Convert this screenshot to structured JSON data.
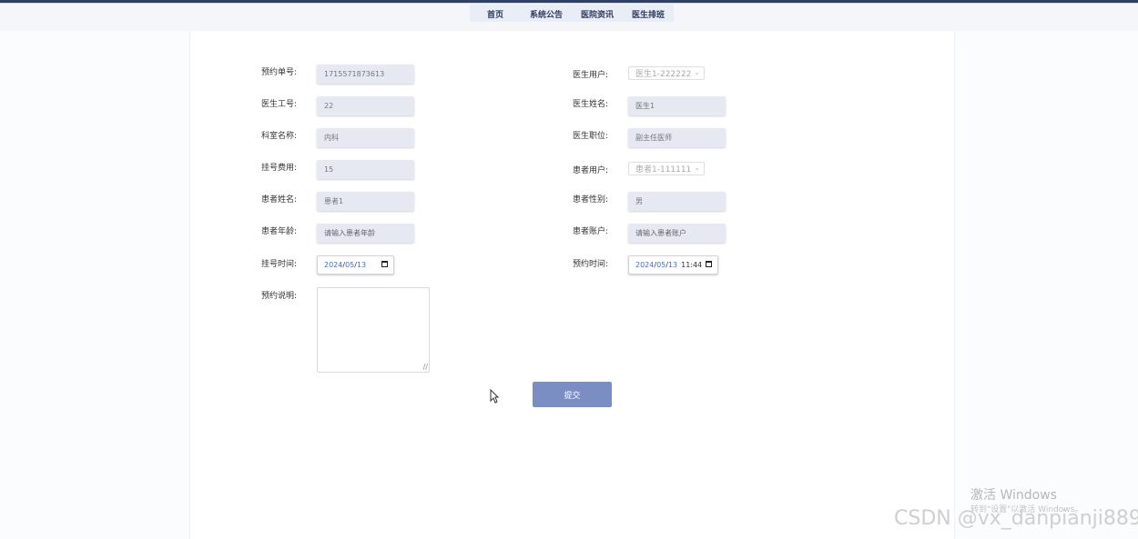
{
  "nav": {
    "items": [
      {
        "label": "首页"
      },
      {
        "label": "系统公告"
      },
      {
        "label": "医院资讯"
      },
      {
        "label": "医生排班"
      }
    ]
  },
  "form": {
    "booking_no": {
      "label": "预约单号:",
      "value": "1715571873613"
    },
    "doctor_user": {
      "label": "医生用户:",
      "value": "医生1-222222"
    },
    "doctor_id": {
      "label": "医生工号:",
      "value": "22"
    },
    "doctor_name": {
      "label": "医生姓名:",
      "value": "医生1"
    },
    "department": {
      "label": "科室名称:",
      "value": "内科"
    },
    "doctor_title": {
      "label": "医生职位:",
      "value": "副主任医师"
    },
    "reg_fee": {
      "label": "挂号费用:",
      "value": "15"
    },
    "patient_user": {
      "label": "患者用户:",
      "value": "患者1-111111"
    },
    "patient_name": {
      "label": "患者姓名:",
      "value": "患者1"
    },
    "patient_gender": {
      "label": "患者性别:",
      "value": "男"
    },
    "patient_age": {
      "label": "患者年龄:",
      "placeholder": "请输入患者年龄"
    },
    "patient_account": {
      "label": "患者账户:",
      "placeholder": "请输入患者账户"
    },
    "reg_time": {
      "label": "挂号时间:",
      "year": "2024",
      "month": "05",
      "day": "13",
      "sep": "/"
    },
    "booking_time": {
      "label": "预约时间:",
      "year": "2024",
      "month": "05",
      "day": "13",
      "time": "11:44",
      "sep": "/"
    },
    "booking_note": {
      "label": "预约说明:"
    },
    "submit_label": "提交"
  },
  "overlay": {
    "activate_title": "激活 Windows",
    "activate_sub": "转到\"设置\"以激活 Windows。",
    "watermark": "CSDN @vx_danpianji889"
  },
  "colors": {
    "header_bar": "#2f3f66",
    "input_bg": "#e6e9f1",
    "submit_bg": "#7b8ec4",
    "date_blue": "#3b6fd4"
  }
}
